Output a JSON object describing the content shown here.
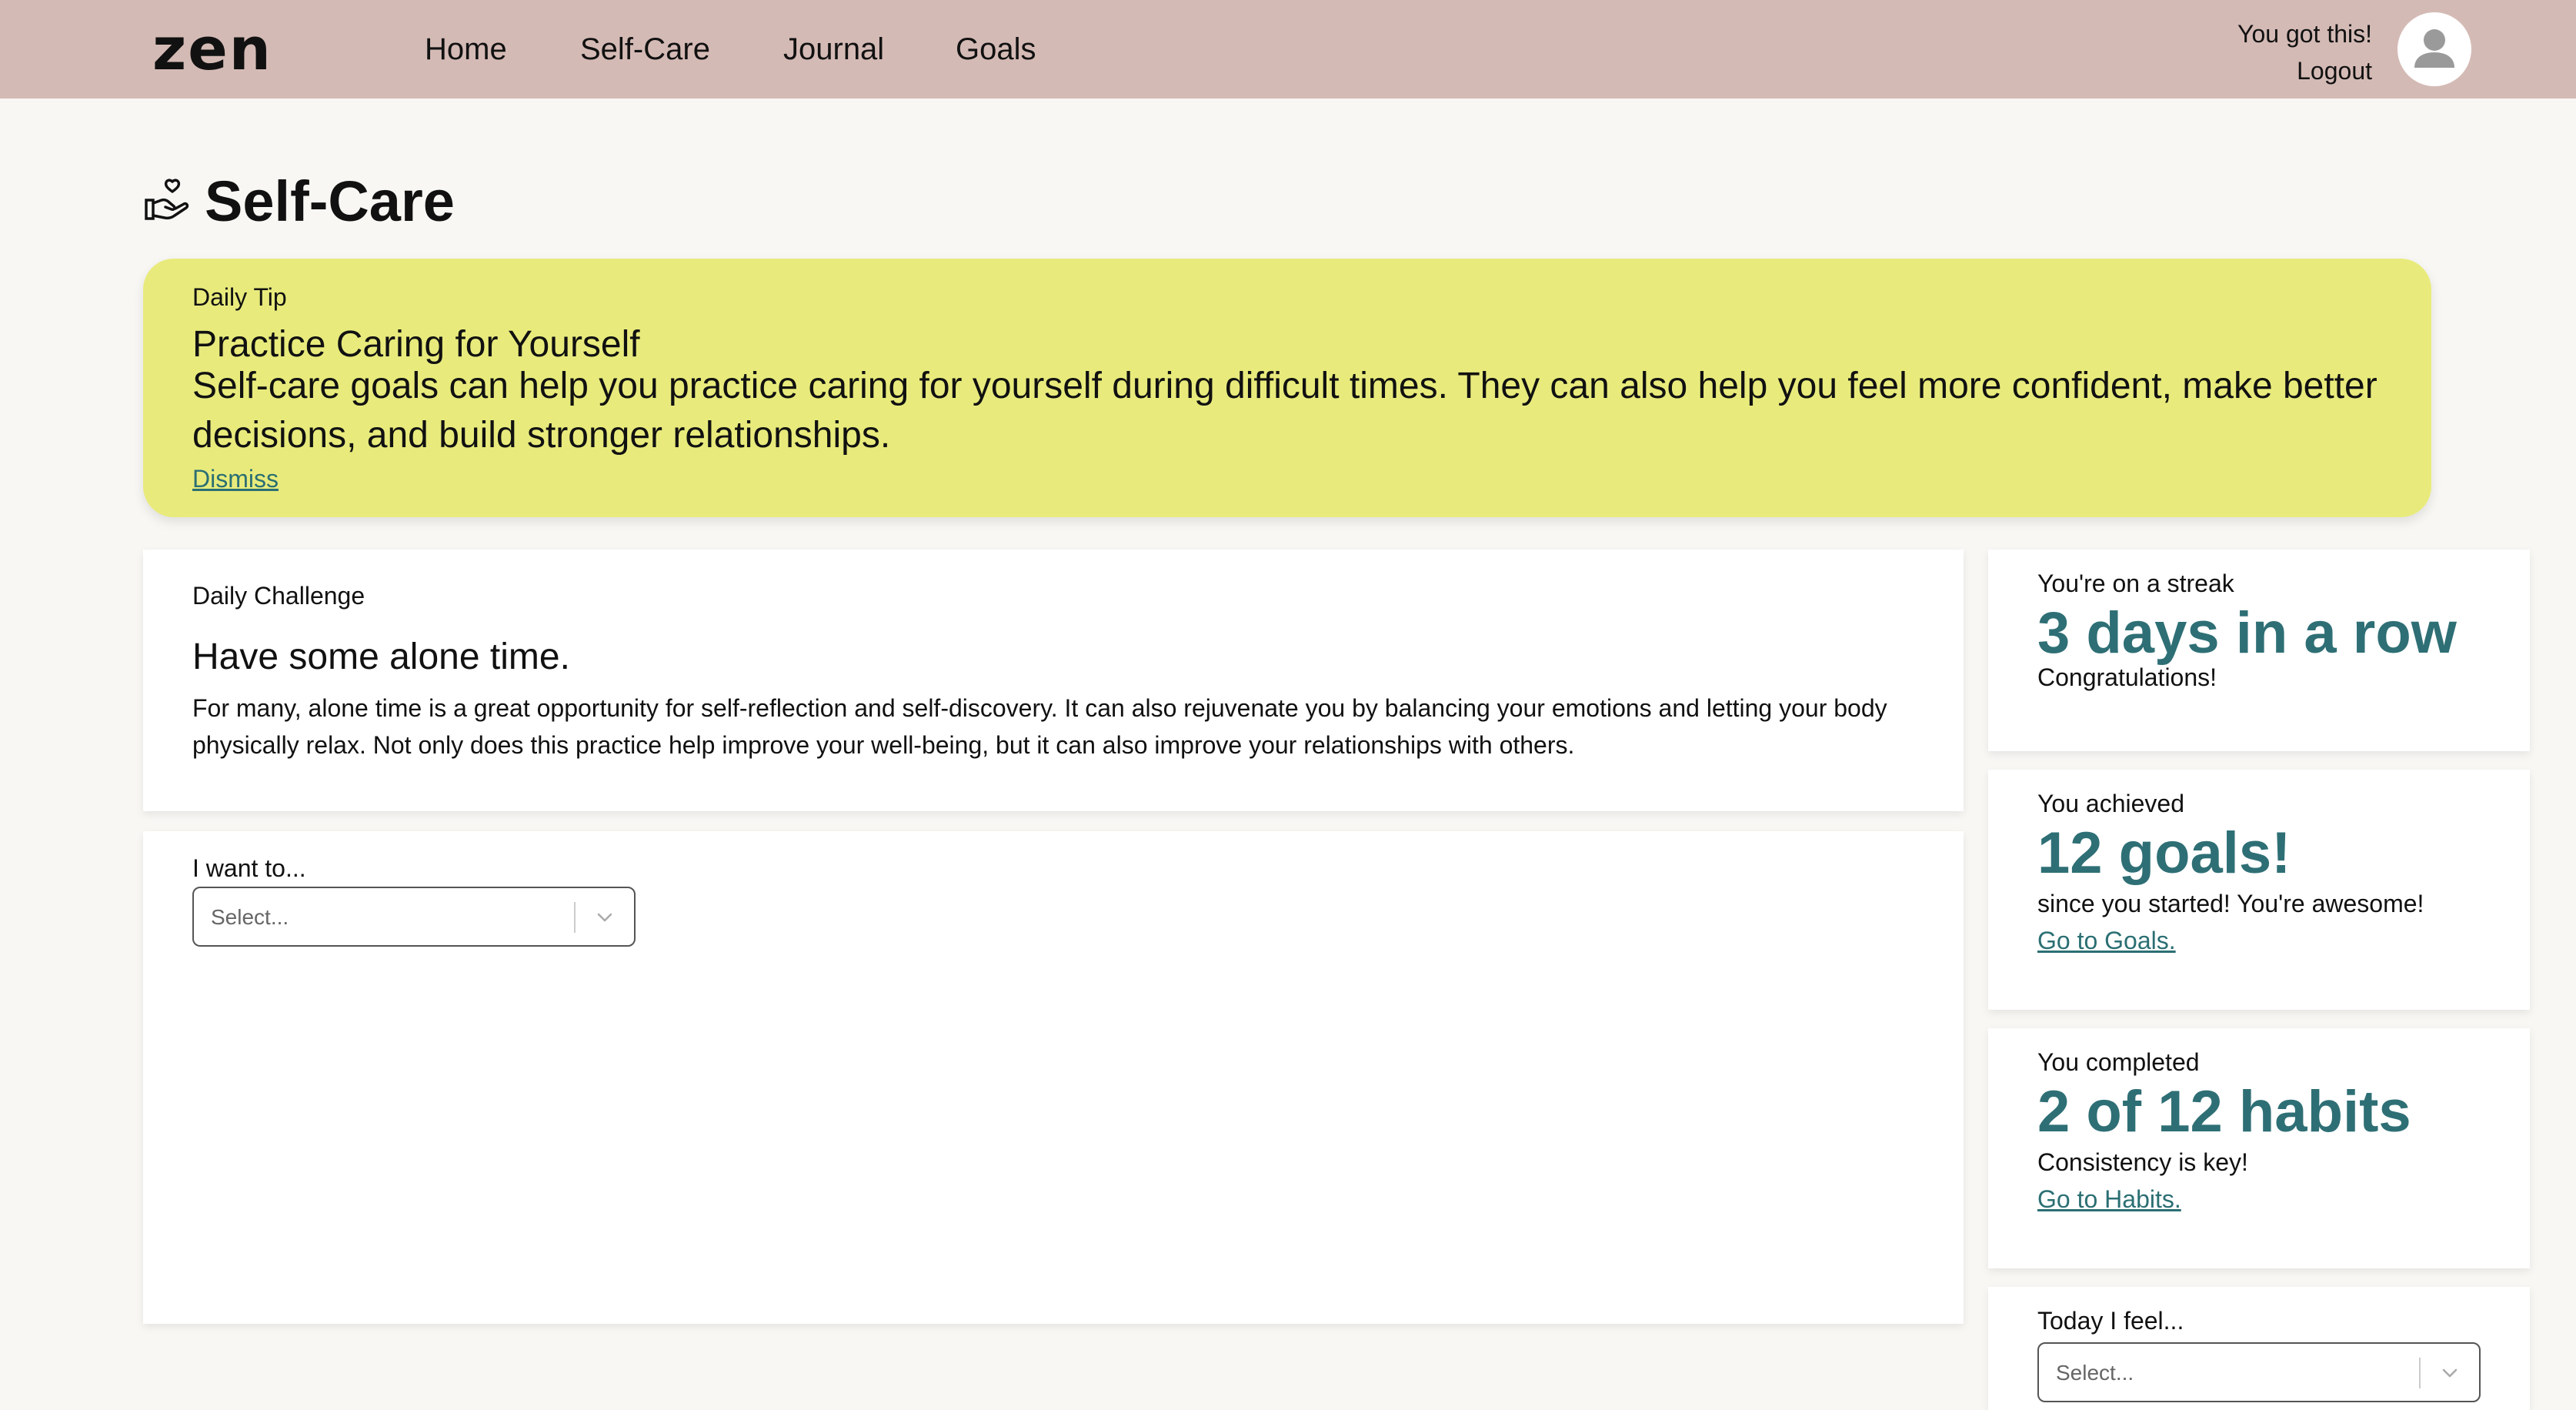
{
  "header": {
    "logo": "zen",
    "nav": [
      "Home",
      "Self-Care",
      "Journal",
      "Goals"
    ],
    "greeting": "You got this!",
    "logout": "Logout"
  },
  "page": {
    "title": "Self-Care",
    "title_icon": "hand-heart-icon"
  },
  "tip": {
    "kicker": "Daily Tip",
    "title": "Practice Caring for Yourself",
    "body": "Self-care goals can help you practice caring for yourself during difficult times. They can also help you feel more confident, make better decisions, and build stronger relationships.",
    "dismiss": "Dismiss"
  },
  "challenge": {
    "kicker": "Daily Challenge",
    "title": "Have some alone time.",
    "body": "For many, alone time is a great opportunity for self-reflection and self-discovery. It can also rejuvenate you by balancing your emotions and letting your body physically relax. Not only does this practice help improve your well-being, but it can also improve your relationships with others."
  },
  "want": {
    "label": "I want to...",
    "placeholder": "Select..."
  },
  "stats": {
    "streak": {
      "kicker": "You're on a streak",
      "big": "3 days in a row",
      "sub": "Congratulations!"
    },
    "goals": {
      "kicker": "You achieved",
      "big": "12 goals!",
      "sub": "since you started! You're awesome!",
      "link": "Go to Goals."
    },
    "habits": {
      "kicker": "You completed",
      "big": "2 of 12 habits",
      "sub": "Consistency is key!",
      "link": "Go to Habits."
    },
    "feel": {
      "label": "Today I feel...",
      "placeholder": "Select..."
    }
  },
  "colors": {
    "header_bg": "#d4bab5",
    "tip_bg": "#e8eb7c",
    "accent": "#2e6f75",
    "page_bg": "#f8f7f4"
  }
}
